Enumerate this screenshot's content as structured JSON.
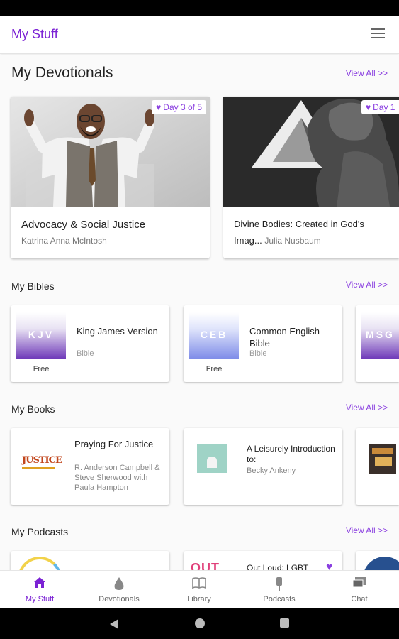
{
  "app": {
    "title": "My Stuff",
    "menu_icon": "hamburger-menu-icon"
  },
  "devotionals": {
    "heading": "My Devotionals",
    "view_all": "View All >>",
    "items": [
      {
        "title": "Advocacy & Social Justice",
        "author": "Katrina Anna McIntosh",
        "badge": "Day 3 of 5"
      },
      {
        "title": "Divine Bodies: Created in God's",
        "title2": "Imag...",
        "author": "Julia Nusbaum",
        "badge": "Day 1"
      }
    ]
  },
  "bibles": {
    "heading": "My Bibles",
    "view_all": "View All >>",
    "items": [
      {
        "code": "KJV",
        "name": "King James Version",
        "type": "Bible",
        "price": "Free"
      },
      {
        "code": "CEB",
        "name": "Common English Bible",
        "type": "Bible",
        "price": "Free"
      },
      {
        "code": "MSG"
      }
    ]
  },
  "books": {
    "heading": "My Books",
    "view_all": "View All >>",
    "items": [
      {
        "title": "Praying For Justice",
        "author": "R. Anderson Campbell & Steve Sherwood with Paula Hampton",
        "cover_text": "JUSTICE"
      },
      {
        "title": "A Leisurely Introduction to:",
        "author": "Becky Ankeny"
      },
      {
        "title": ""
      }
    ]
  },
  "podcasts": {
    "heading": "My Podcasts",
    "view_all": "View All >>",
    "items": [
      {
        "title": ""
      },
      {
        "title": "Out Loud: LGBT",
        "cover_text": "OUT"
      }
    ]
  },
  "nav": [
    {
      "label": "My Stuff",
      "icon": "home-icon",
      "active": true
    },
    {
      "label": "Devotionals",
      "icon": "flame-drop-icon"
    },
    {
      "label": "Library",
      "icon": "open-book-icon"
    },
    {
      "label": "Podcasts",
      "icon": "microphone-icon"
    },
    {
      "label": "Chat",
      "icon": "chat-bubble-icon"
    }
  ],
  "colors": {
    "accent": "#7b22d4",
    "link": "#8a3fe0"
  }
}
